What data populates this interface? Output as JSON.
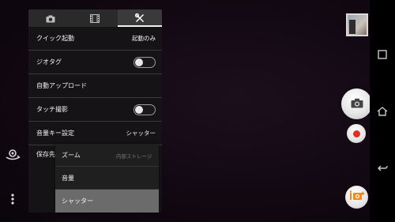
{
  "settings": {
    "tabs": [
      {
        "icon": "camera-icon",
        "active": false
      },
      {
        "icon": "film-icon",
        "active": false
      },
      {
        "icon": "tools-icon",
        "active": true
      }
    ],
    "rows": [
      {
        "label": "クイック起動",
        "value": "起動のみ"
      },
      {
        "label": "ジオタグ",
        "toggle": false
      },
      {
        "label": "自動アップロード"
      },
      {
        "label": "タッチ撮影",
        "toggle": false
      },
      {
        "label": "音量キー設定",
        "value": "シャッター"
      }
    ],
    "save_label": "保存先",
    "storage_hint": "内部ストレージ"
  },
  "dropdown": {
    "options": [
      "ズーム",
      "音量",
      "シャッター"
    ],
    "selected": "シャッター"
  },
  "colors": {
    "record": "#e03024",
    "panel": "#161416",
    "selected": "#6b6b6b"
  }
}
